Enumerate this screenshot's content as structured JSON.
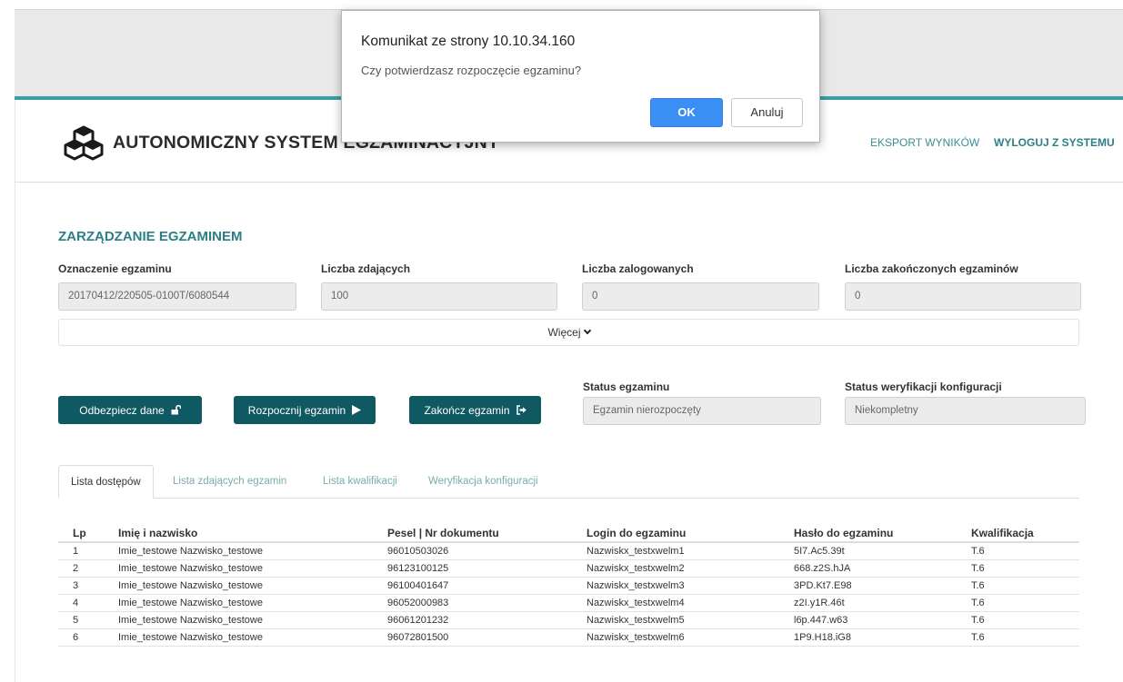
{
  "header": {
    "app_title": "AUTONOMICZNY SYSTEM EGZAMINACYJNY",
    "nav": {
      "export": "EKSPORT WYNIKÓW",
      "logout": "WYLOGUJ Z SYSTEMU"
    }
  },
  "exam": {
    "section_title": "ZARZĄDZANIE EGZAMINEM",
    "fields": [
      {
        "label": "Oznaczenie egzaminu",
        "value": "20170412/220505-0100T/6080544"
      },
      {
        "label": "Liczba zdających",
        "value": "100"
      },
      {
        "label": "Liczba zalogowanych",
        "value": "0"
      },
      {
        "label": "Liczba zakończonych egzaminów",
        "value": "0"
      }
    ],
    "more_label": "Więcej",
    "status": [
      {
        "label": "Status egzaminu",
        "value": "Egzamin nierozpoczęty"
      },
      {
        "label": "Status weryfikacji konfiguracji",
        "value": "Niekompletny"
      }
    ]
  },
  "actions": {
    "unlock": "Odbezpiecz dane",
    "start": "Rozpocznij egzamin",
    "end": "Zakończ egzamin"
  },
  "tabs": [
    "Lista dostępów",
    "Lista zdających egzamin",
    "Lista kwalifikacji",
    "Weryfikacja konfiguracji"
  ],
  "table": {
    "columns": [
      "Lp",
      "Imię i nazwisko",
      "Pesel | Nr dokumentu",
      "Login do egzaminu",
      "Hasło do egzaminu",
      "Kwalifikacja"
    ],
    "rows": [
      [
        "1",
        "Imie_testowe Nazwisko_testowe",
        "96010503026",
        "Nazwiskx_testxwelm1",
        "5I7.Ac5.39t",
        "T.6"
      ],
      [
        "2",
        "Imie_testowe Nazwisko_testowe",
        "96123100125",
        "Nazwiskx_testxwelm2",
        "668.z2S.hJA",
        "T.6"
      ],
      [
        "3",
        "Imie_testowe Nazwisko_testowe",
        "96100401647",
        "Nazwiskx_testxwelm3",
        "3PD.Kt7.E98",
        "T.6"
      ],
      [
        "4",
        "Imie_testowe Nazwisko_testowe",
        "96052000983",
        "Nazwiskx_testxwelm4",
        "z2I.y1R.46t",
        "T.6"
      ],
      [
        "5",
        "Imie_testowe Nazwisko_testowe",
        "96061201232",
        "Nazwiskx_testxwelm5",
        "l6p.447.w63",
        "T.6"
      ],
      [
        "6",
        "Imie_testowe Nazwisko_testowe",
        "96072801500",
        "Nazwiskx_testxwelm6",
        "1P9.H18.iG8",
        "T.6"
      ]
    ]
  },
  "dialog": {
    "title": "Komunikat ze strony 10.10.34.160",
    "message": "Czy potwierdzasz rozpoczęcie egzaminu?",
    "ok": "OK",
    "cancel": "Anuluj"
  },
  "colors": {
    "accent": "#3a9fa4",
    "button": "#0f5962",
    "dialog_ok": "#3b8ef4"
  },
  "icons": {
    "logo": "cubes-logo-icon",
    "unlock": "unlock-icon",
    "start": "play-icon",
    "end": "sign-out-icon",
    "more": "chevron-down-icon"
  }
}
